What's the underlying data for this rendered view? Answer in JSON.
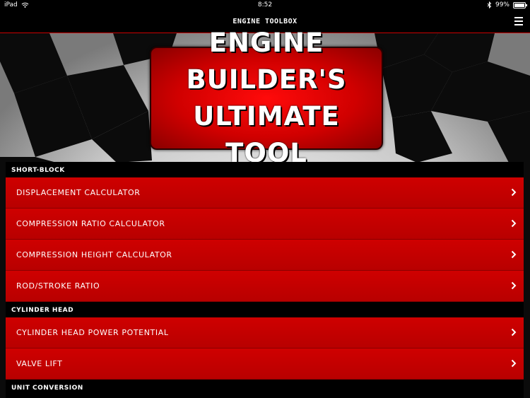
{
  "status_bar": {
    "carrier": "iPad",
    "time": "8:52",
    "battery_percent": "99%",
    "battery_level": 0.99
  },
  "nav": {
    "title": "ENGINE TOOLBOX",
    "menu_icon": "hamburger-menu-icon"
  },
  "banner": {
    "line1": "ENGINE BUILDER'S",
    "line2": "ULTIMATE TOOL"
  },
  "sections": [
    {
      "header": "SHORT-BLOCK",
      "items": [
        {
          "label": "DISPLACEMENT CALCULATOR"
        },
        {
          "label": "COMPRESSION RATIO CALCULATOR"
        },
        {
          "label": "COMPRESSION HEIGHT CALCULATOR"
        },
        {
          "label": "ROD/STROKE RATIO"
        }
      ]
    },
    {
      "header": "CYLINDER HEAD",
      "items": [
        {
          "label": "CYLINDER HEAD POWER POTENTIAL"
        },
        {
          "label": "VALVE LIFT"
        }
      ]
    },
    {
      "header": "UNIT CONVERSION",
      "items": []
    }
  ],
  "colors": {
    "accent_red": "#c40000",
    "background": "#000000",
    "text": "#ffffff"
  }
}
